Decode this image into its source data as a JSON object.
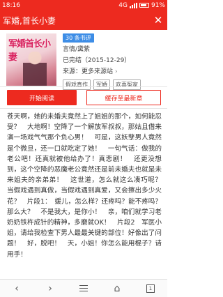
{
  "status_bar": {
    "time": "18:16",
    "network": "4G",
    "battery": "91%"
  },
  "header": {
    "title": "军婚,首长小妻"
  },
  "book": {
    "cover_title": "军婚首长小妻",
    "review_badge": "30 条书评",
    "author": "言情/黛紫",
    "status": "已完结（2015-12-29）",
    "source": "来源：更多来源站",
    "source_arrow": "›",
    "tags": [
      "假戏真作",
      "军婚",
      "欢喜冤家"
    ]
  },
  "actions": {
    "start_reading": "开始阅读",
    "cache_latest": "缓存至最新章"
  },
  "content": {
    "text": "苍天啊，她的未婚夫竟然上了姐姐的那个，如何能忍受？　大地啊！空降了一个解放军叔叔，那姑且借来演一场戏气气那个负心男！　可是，这妖孽男人竟然是个微旦，还一口就吃定了她！　一句气话：做我的老公吧！还真就被他给办了！真悲剧！　还更没想到，这个空降的恶魔老公竟然还是前未婚夫也就是未来姐夫的亲弟弟！　这世道，怎么就这么凑巧呢？　当假戏遇到真做，当假戏遇到真爱，又会擦出多少火花？　片段1：　媛儿，怎么样？还疼吗？能不疼吗？那么大？　不是我大，是你小！　亲，咱们就学习老奶奶铁杵成针的精神，多磨就OK！　片段2　军医小姐，请给我检查下男人最最关键的部位！好像出了问题！　好，脱吧！　天，小姐！你怎么能用棍子？请用手！"
  },
  "bottom_nav": {
    "tab_count": "1"
  }
}
